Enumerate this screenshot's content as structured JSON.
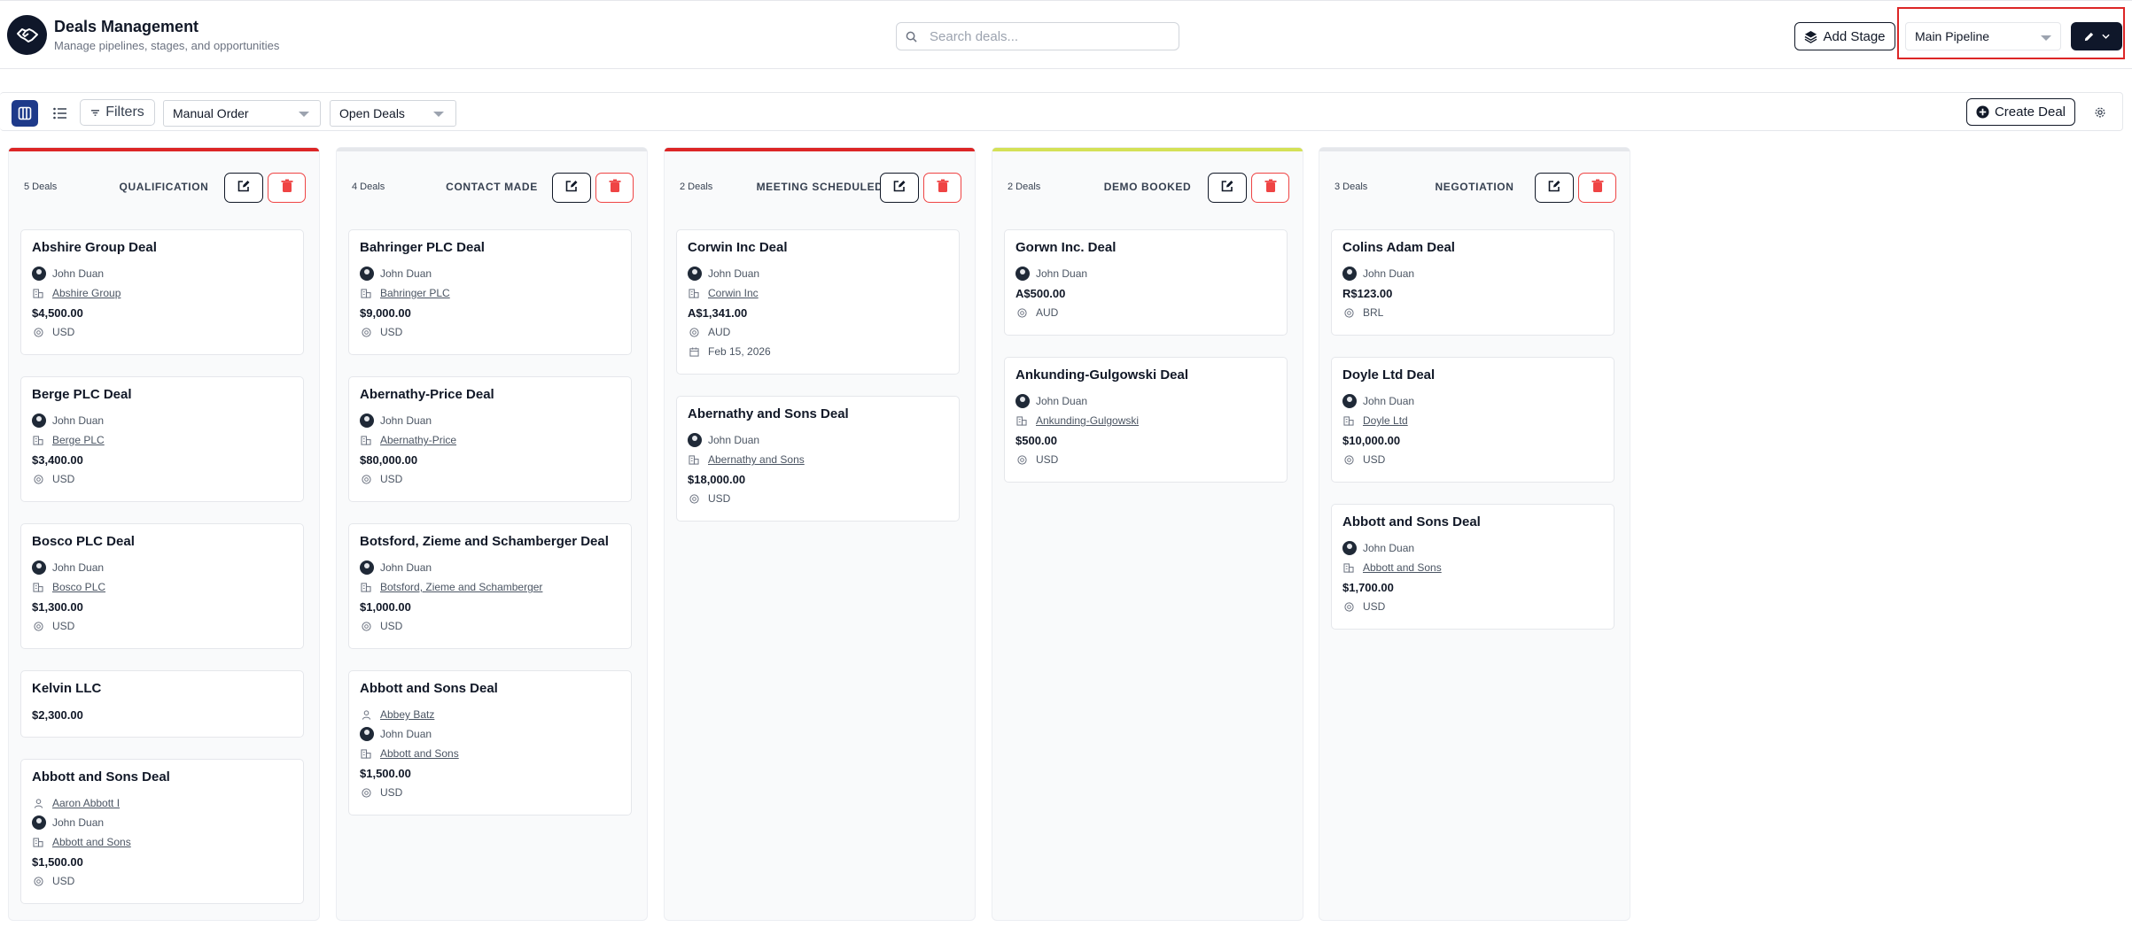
{
  "header": {
    "title": "Deals Management",
    "subtitle": "Manage pipelines, stages, and opportunities",
    "search_placeholder": "Search deals...",
    "add_stage_label": "Add Stage",
    "pipeline_selected": "Main Pipeline"
  },
  "toolbar": {
    "filters_label": "Filters",
    "sort_selected": "Manual Order",
    "status_selected": "Open Deals",
    "create_deal_label": "Create Deal"
  },
  "colors": {
    "qualification_accent": "#dc2626",
    "contact_made_accent": "#e5e7eb",
    "meeting_scheduled_accent": "#dc2626",
    "demo_booked_accent": "#d4e157",
    "negotiation_accent": "#e5e7eb"
  },
  "columns": [
    {
      "name": "QUALIFICATION",
      "count": "5 Deals",
      "cards": [
        {
          "title": "Abshire Group Deal",
          "owner": "John Duan",
          "company": "Abshire Group",
          "amount": "$4,500.00",
          "currency": "USD"
        },
        {
          "title": "Berge PLC Deal",
          "owner": "John Duan",
          "company": "Berge PLC",
          "amount": "$3,400.00",
          "currency": "USD"
        },
        {
          "title": "Bosco PLC Deal",
          "owner": "John Duan",
          "company": "Bosco PLC",
          "amount": "$1,300.00",
          "currency": "USD"
        },
        {
          "title": "Kelvin LLC",
          "amount": "$2,300.00"
        },
        {
          "title": "Abbott and Sons Deal",
          "contact": "Aaron Abbott I",
          "owner": "John Duan",
          "company": "Abbott and Sons",
          "amount": "$1,500.00",
          "currency": "USD"
        }
      ]
    },
    {
      "name": "CONTACT MADE",
      "count": "4 Deals",
      "cards": [
        {
          "title": "Bahringer PLC Deal",
          "owner": "John Duan",
          "company": "Bahringer PLC",
          "amount": "$9,000.00",
          "currency": "USD"
        },
        {
          "title": "Abernathy-Price Deal",
          "owner": "John Duan",
          "company": "Abernathy-Price",
          "amount": "$80,000.00",
          "currency": "USD"
        },
        {
          "title": "Botsford, Zieme and Schamberger Deal",
          "owner": "John Duan",
          "company": "Botsford, Zieme and Schamberger",
          "amount": "$1,000.00",
          "currency": "USD"
        },
        {
          "title": "Abbott and Sons Deal",
          "contact": "Abbey Batz",
          "owner": "John Duan",
          "company": "Abbott and Sons",
          "amount": "$1,500.00",
          "currency": "USD"
        }
      ]
    },
    {
      "name": "MEETING SCHEDULED",
      "count": "2 Deals",
      "cards": [
        {
          "title": "Corwin Inc Deal",
          "owner": "John Duan",
          "company": "Corwin Inc",
          "amount": "A$1,341.00",
          "currency": "AUD",
          "date": "Feb 15, 2026"
        },
        {
          "title": "Abernathy and Sons Deal",
          "owner": "John Duan",
          "company": "Abernathy and Sons",
          "amount": "$18,000.00",
          "currency": "USD"
        }
      ]
    },
    {
      "name": "DEMO BOOKED",
      "count": "2 Deals",
      "cards": [
        {
          "title": "Gorwn Inc. Deal",
          "owner": "John Duan",
          "amount": "A$500.00",
          "currency": "AUD"
        },
        {
          "title": "Ankunding-Gulgowski Deal",
          "owner": "John Duan",
          "company": "Ankunding-Gulgowski",
          "amount": "$500.00",
          "currency": "USD"
        }
      ]
    },
    {
      "name": "NEGOTIATION",
      "count": "3 Deals",
      "cards": [
        {
          "title": "Colins Adam Deal",
          "owner": "John Duan",
          "amount": "R$123.00",
          "currency": "BRL"
        },
        {
          "title": "Doyle Ltd Deal",
          "owner": "John Duan",
          "company": "Doyle Ltd",
          "amount": "$10,000.00",
          "currency": "USD"
        },
        {
          "title": "Abbott and Sons Deal",
          "owner": "John Duan",
          "company": "Abbott and Sons",
          "amount": "$1,700.00",
          "currency": "USD"
        }
      ]
    }
  ]
}
